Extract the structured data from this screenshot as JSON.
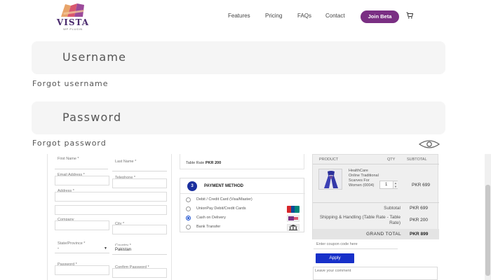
{
  "header": {
    "logo_text": "VISTA",
    "logo_sub": "WP PLUGIN",
    "nav": [
      "Features",
      "Pricing",
      "FAQs",
      "Contact"
    ],
    "cta": "Join Beta",
    "brand_color": "#7a2f83",
    "cart_icon": "cart-icon"
  },
  "login": {
    "username_placeholder": "Username",
    "forgot_username": "Forgot username",
    "password_placeholder": "Password",
    "forgot_password": "Forgot password",
    "eye_icon": "eye-icon"
  },
  "billing": {
    "first_name": "First Name *",
    "last_name": "Last Name *",
    "email": "Email Address *",
    "telephone": "Telephone *",
    "address": "Address *",
    "company": "Company",
    "city": "City *",
    "state": "State/Province *",
    "state_value": "-",
    "country": "Country *",
    "country_value": "Pakistan",
    "password": "Password *",
    "confirm_password": "Confirm Password *"
  },
  "shipping": {
    "rate_label": "Table Rate",
    "rate_value": "PKR 200"
  },
  "payment": {
    "step": "3",
    "title": "PAYMENT METHOD",
    "options": [
      {
        "label": "Debit / Credit Card (Visa/Master)",
        "selected": false,
        "logo": ""
      },
      {
        "label": "UnionPay Debit/Credit Cards",
        "selected": false,
        "logo": "unionpay-logo"
      },
      {
        "label": "Cash on Delivery",
        "selected": true,
        "logo": "cod-logo"
      },
      {
        "label": "Bank Transfer",
        "selected": false,
        "logo": "bank-icon"
      }
    ],
    "accent": "#1a2f9e"
  },
  "order": {
    "headers": {
      "product": "PRODUCT",
      "qty": "QTY",
      "subtotal": "SUBTOTAL"
    },
    "item": {
      "name": "HealthCare Online Traditional Scarves For Women (0004)",
      "qty": "1",
      "price": "PKR 699"
    },
    "subtotal_label": "Subtotal",
    "subtotal_value": "PKR 699",
    "shipping_label": "Shipping & Handling (Table Rate - Table Rate)",
    "shipping_value": "PKR 200",
    "grand_label": "GRAND TOTAL",
    "grand_value": "PKR 899"
  },
  "coupon": {
    "placeholder": "Enter coupon code here",
    "apply": "Apply",
    "button_color": "#1730c9"
  },
  "comment": {
    "placeholder": "Leave your comment"
  }
}
